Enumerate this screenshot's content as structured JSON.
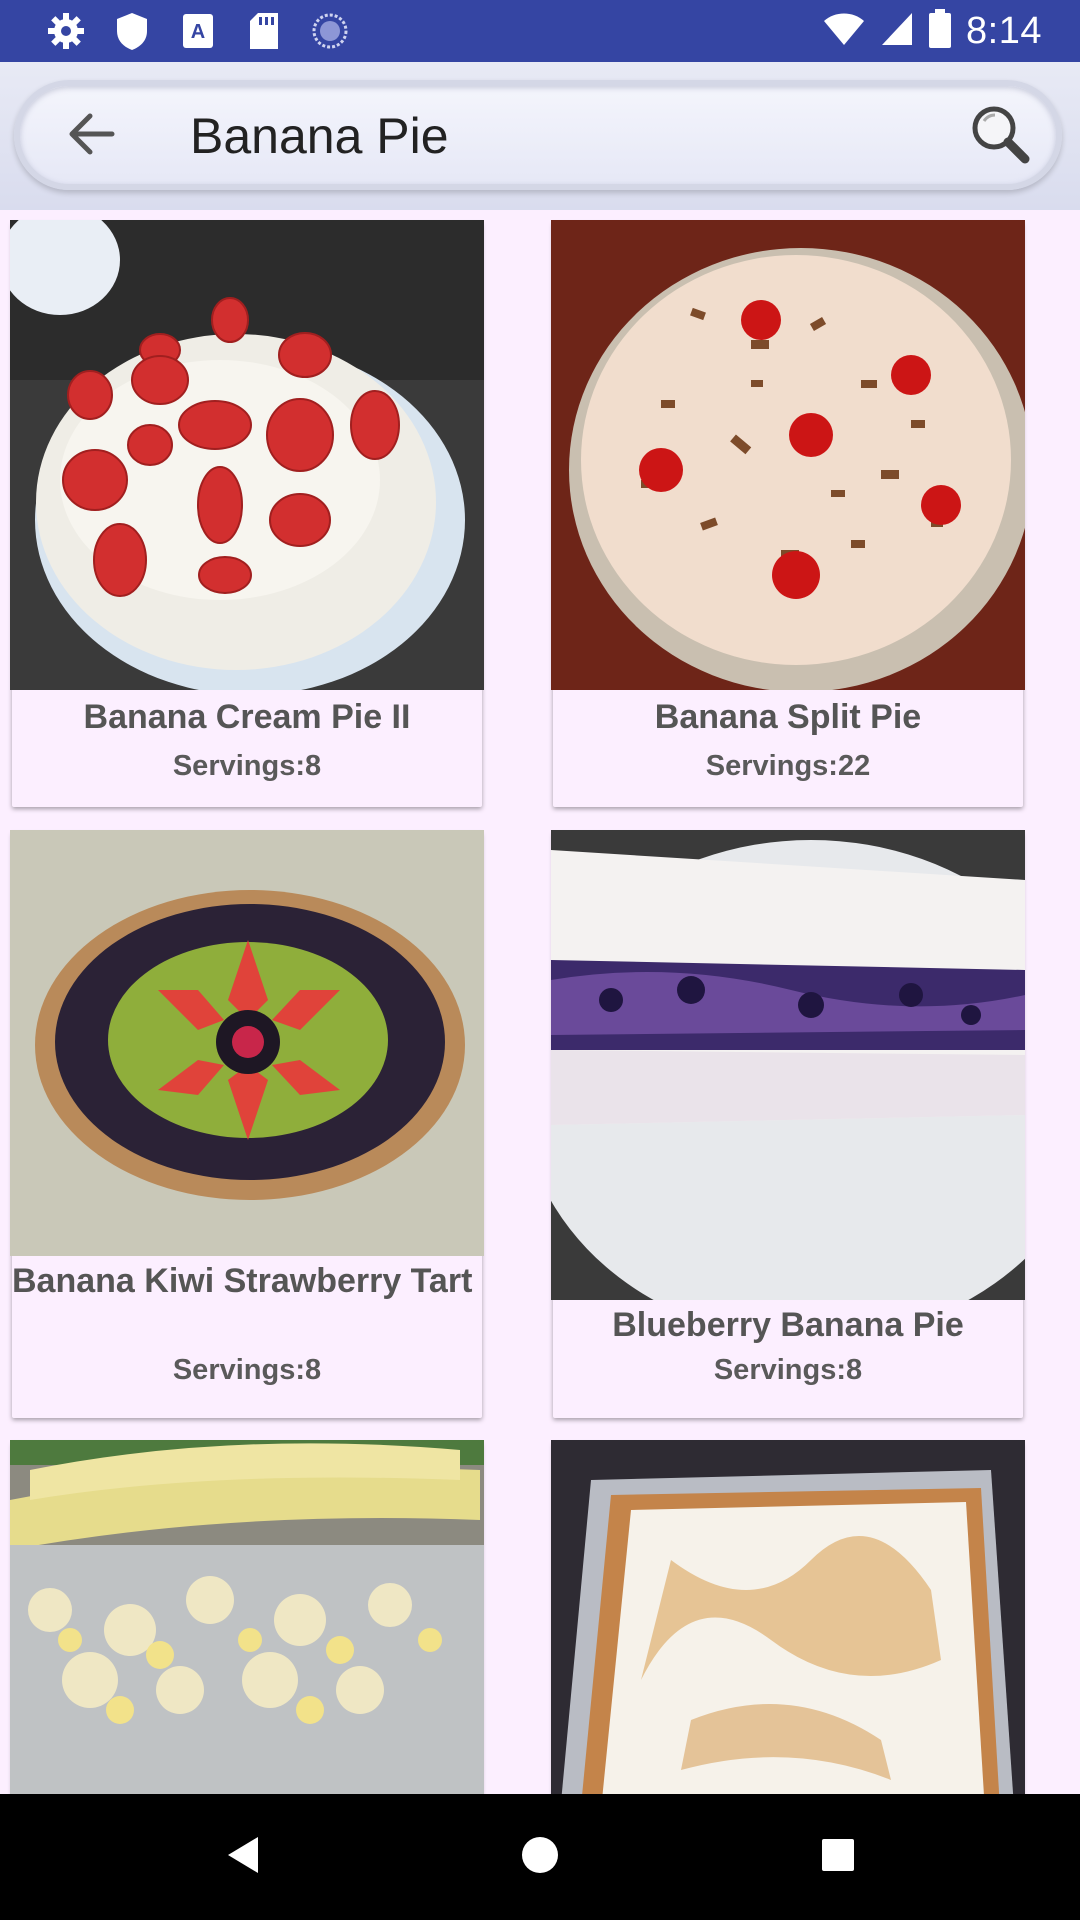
{
  "status_bar": {
    "time": "8:14",
    "left_icons": [
      "settings-icon",
      "shield-icon",
      "font-a-icon",
      "sd-card-icon",
      "sync-circle-icon"
    ],
    "right_icons": [
      "wifi-icon",
      "signal-icon",
      "battery-icon"
    ]
  },
  "search": {
    "query": "Banana Pie",
    "back_icon": "arrow-left-icon",
    "search_icon": "magnifier-icon"
  },
  "recipes": [
    {
      "title": "Banana Cream Pie II",
      "servings": "Servings:8",
      "image": "strawberry-cream-pie"
    },
    {
      "title": "Banana Split Pie",
      "servings": "Servings:22",
      "image": "cherry-cream-pie"
    },
    {
      "title": "Banana Kiwi Strawberry Tart",
      "servings": "Servings:8",
      "image": "fruit-berry-tart"
    },
    {
      "title": "Blueberry Banana Pie",
      "servings": "Servings:8",
      "image": "blueberry-pie-slice"
    },
    {
      "title": "",
      "servings": "",
      "image": "banana-pineapple-dish"
    },
    {
      "title": "",
      "servings": "",
      "image": "meringue-pudding-tray"
    }
  ],
  "nav_bar": {
    "buttons": [
      "back-triangle-icon",
      "home-circle-icon",
      "recents-square-icon"
    ]
  }
}
